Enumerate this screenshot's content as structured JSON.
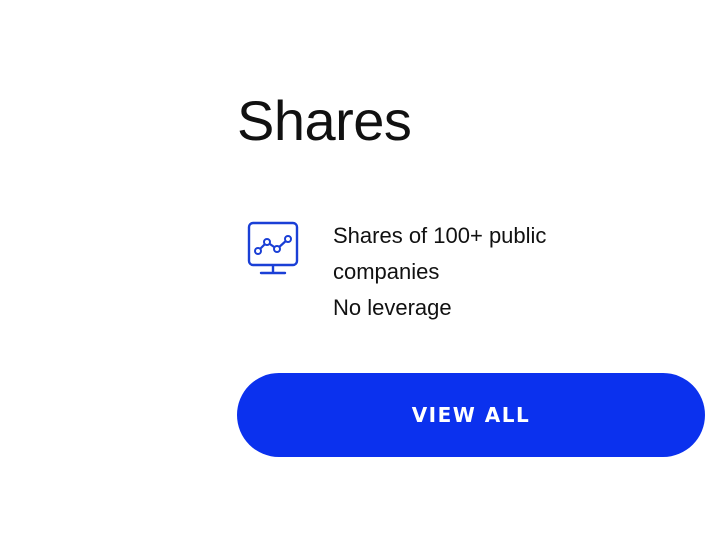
{
  "section": {
    "title": "Shares"
  },
  "feature": {
    "icon": "chart-monitor-icon",
    "line1": "Shares of 100+ public companies",
    "line2": "No leverage"
  },
  "button": {
    "label": "VIEW ALL"
  },
  "colors": {
    "accent": "#0b31ee",
    "icon_stroke": "#1a3fd6",
    "text": "#111111",
    "background": "#ffffff"
  }
}
